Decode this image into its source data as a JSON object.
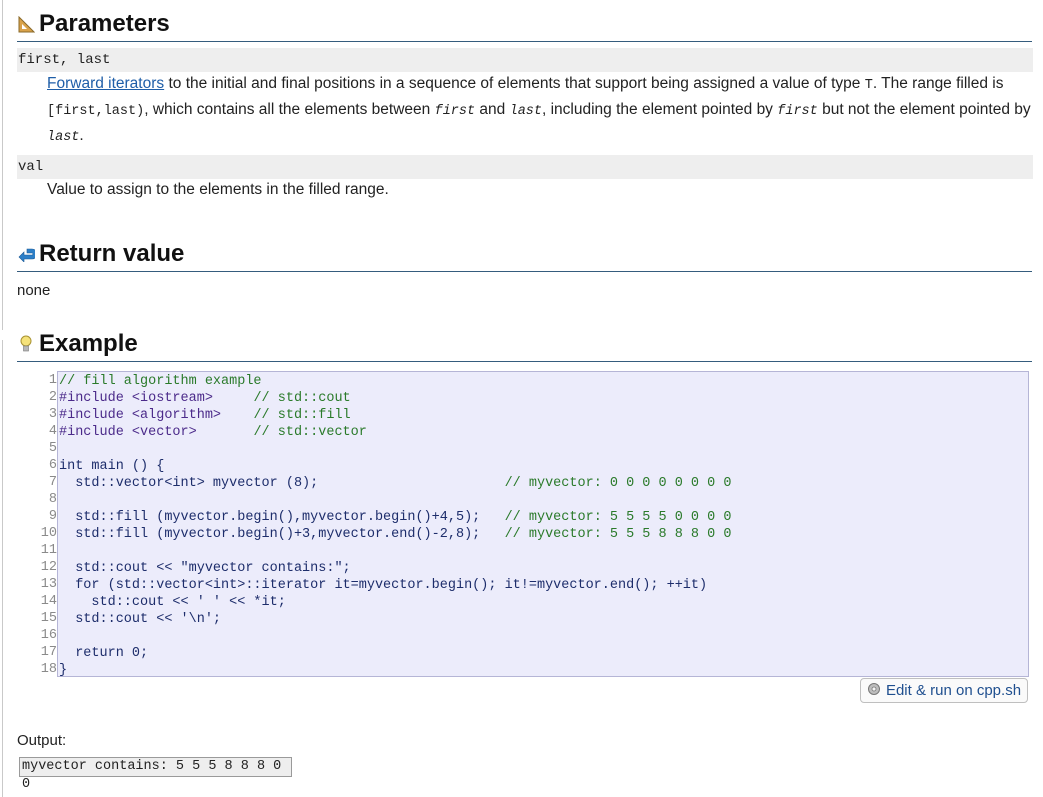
{
  "parameters": {
    "title": "Parameters",
    "icon": "ruler-triangle-icon",
    "items": [
      {
        "term": "first, last",
        "link_text": "Forward iterators",
        "desc_part1": " to the initial and final positions in a sequence of elements that support being assigned a value of type ",
        "type_T": "T",
        "desc_part2": ". The range filled is ",
        "range": "[first,last)",
        "desc_part3": ", which contains all the elements between ",
        "first": "first",
        "and": " and ",
        "last": "last",
        "desc_part4": ", including the element pointed by ",
        "first2": "first",
        "desc_part5": " but not the element pointed by ",
        "last2": "last",
        "period": "."
      },
      {
        "term": "val",
        "desc": "Value to assign to the elements in the filled range."
      }
    ]
  },
  "return_value": {
    "title": "Return value",
    "icon": "return-arrow-icon",
    "text": "none"
  },
  "example": {
    "title": "Example",
    "icon": "lightbulb-icon",
    "line_numbers": [
      "1",
      "2",
      "3",
      "4",
      "5",
      "6",
      "7",
      "8",
      "9",
      "10",
      "11",
      "12",
      "13",
      "14",
      "15",
      "16",
      "17",
      "18"
    ],
    "code_lines": [
      "// fill algorithm example",
      "#include <iostream>     // std::cout",
      "#include <algorithm>    // std::fill",
      "#include <vector>       // std::vector",
      "",
      "int main () {",
      "  std::vector<int> myvector (8);                       // myvector: 0 0 0 0 0 0 0 0",
      "",
      "  std::fill (myvector.begin(),myvector.begin()+4,5);   // myvector: 5 5 5 5 0 0 0 0",
      "  std::fill (myvector.begin()+3,myvector.end()-2,8);   // myvector: 5 5 5 8 8 8 0 0",
      "",
      "  std::cout << \"myvector contains:\";",
      "  for (std::vector<int>::iterator it=myvector.begin(); it!=myvector.end(); ++it)",
      "    std::cout << ' ' << *it;",
      "  std::cout << '\\n';",
      "",
      "  return 0;",
      "}"
    ],
    "run_button": "Edit & run on cpp.sh",
    "run_icon": "gear-icon",
    "output_label": "Output:",
    "output": "myvector contains: 5 5 5 8 8 8 0 0"
  },
  "colors": {
    "heading_rule": "#355c7d",
    "code_bg": "#ececfb",
    "link": "#1f5ea8",
    "comment": "#2a7a2a"
  }
}
